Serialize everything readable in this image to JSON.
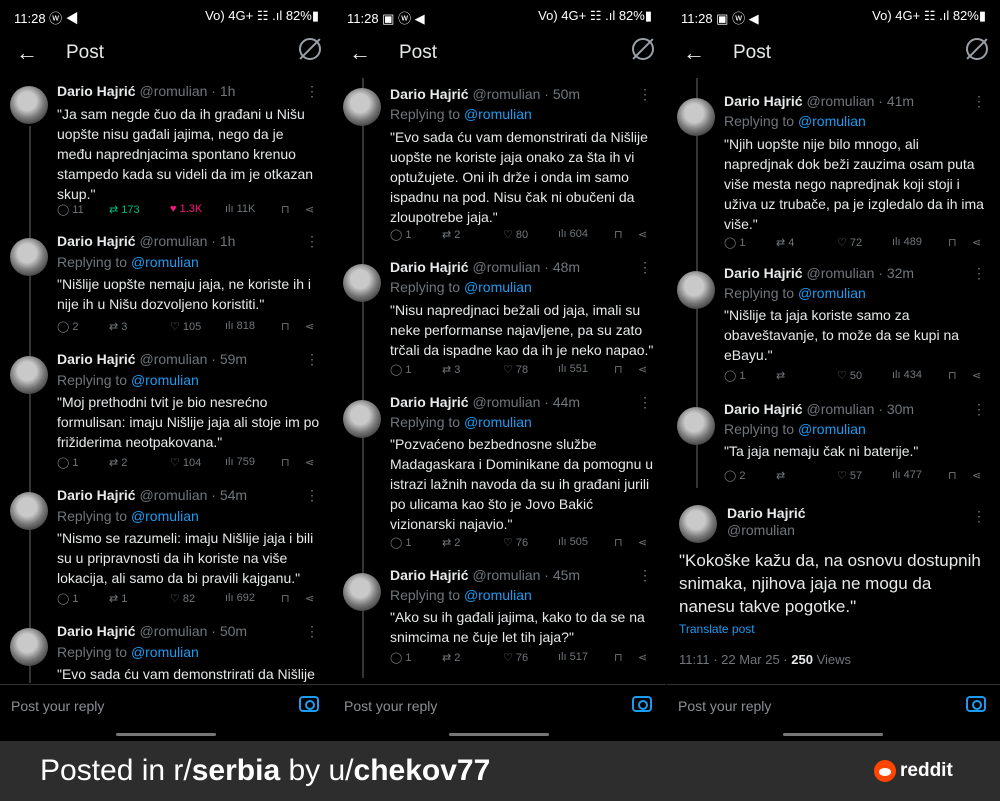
{
  "status": {
    "time": "11:28 ⓦ ◀",
    "time_p1": "11:28 ▣ ⓦ ◀",
    "right": "Vo) 4G+ ☷ .ıl 82%▮"
  },
  "header": {
    "back": "←",
    "title": "Post"
  },
  "reply_placeholder": "Post your reply",
  "panel0": {
    "tweets": [
      {
        "name": "Dario Hajrić",
        "meta": "@romulian · 1h",
        "reply": "",
        "text": "\"Ja sam negde čuo da ih građani u Nišu uopšte nisu gađali jajima, nego da je među naprednjacima spontano krenuo stampedo kada su videli da im je otkazan skup.\"",
        "comments": "11",
        "reposts": "173",
        "likes": "1.3K",
        "views": "11K"
      },
      {
        "name": "Dario Hajrić",
        "meta": "@romulian · 1h",
        "reply": "@romulian",
        "text": "\"Nišlije uopšte nemaju jaja, ne koriste ih i nije ih u Nišu dozvoljeno koristiti.\"",
        "comments": "2",
        "reposts": "3",
        "likes": "105",
        "views": "818"
      },
      {
        "name": "Dario Hajrić",
        "meta": "@romulian · 59m",
        "reply": "@romulian",
        "text": "\"Moj prethodni tvit je bio nesrećno formulisan: imaju Nišlije jaja ali stoje im po frižiderima neotpakovana.\"",
        "comments": "1",
        "reposts": "2",
        "likes": "104",
        "views": "759"
      },
      {
        "name": "Dario Hajrić",
        "meta": "@romulian · 54m",
        "reply": "@romulian",
        "text": "\"Nismo se razumeli: imaju Nišlije jaja i bili su u pripravnosti da ih koriste na više lokacija, ali samo da bi pravili kajganu.\"",
        "comments": "1",
        "reposts": "1",
        "likes": "82",
        "views": "692"
      },
      {
        "name": "Dario Hajrić",
        "meta": "@romulian · 50m",
        "reply": "@romulian",
        "text": "\"Evo sada ću vam demonstrirati da Nišlije",
        "comments": "",
        "reposts": "",
        "likes": "",
        "views": ""
      }
    ]
  },
  "panel1": {
    "tweets": [
      {
        "name": "Dario Hajrić",
        "meta": "@romulian · 50m",
        "reply": "@romulian",
        "text": "\"Evo sada ću vam demonstrirati da Nišlije uopšte ne koriste jaja onako za šta ih vi optužujete. Oni ih drže i onda im samo ispadnu na pod. Nisu čak ni obučeni da zloupotrebe jaja.\"",
        "comments": "1",
        "reposts": "2",
        "likes": "80",
        "views": "604"
      },
      {
        "name": "Dario Hajrić",
        "meta": "@romulian · 48m",
        "reply": "@romulian",
        "text": "\"Nisu napredjnaci bežali od jaja, imali su neke performanse najavljene, pa su zato trčali da ispadne kao da ih je neko napao.\"",
        "comments": "1",
        "reposts": "3",
        "likes": "78",
        "views": "551"
      },
      {
        "name": "Dario Hajrić",
        "meta": "@romulian · 44m",
        "reply": "@romulian",
        "text": "\"Pozvaćeno bezbednosne službe Madagaskara i Dominikane da pomognu u istrazi lažnih navoda da su ih građani jurili po ulicama kao što je Jovo Bakić vizionarski najavio.\"",
        "comments": "1",
        "reposts": "2",
        "likes": "76",
        "views": "505"
      },
      {
        "name": "Dario Hajrić",
        "meta": "@romulian · 45m",
        "reply": "@romulian",
        "text": "\"Ako su ih gađali jajima, kako to da se na snimcima ne čuje let tih jaja?\"",
        "comments": "1",
        "reposts": "2",
        "likes": "76",
        "views": "517"
      }
    ]
  },
  "panel2": {
    "tweets": [
      {
        "name": "Dario Hajrić",
        "meta": "@romulian · 41m",
        "reply": "@romulian",
        "text": "\"Njih uopšte nije bilo mnogo, ali napredjnak dok beži zauzima osam puta više mesta nego napredjnak koji stoji i uživa uz trubače, pa je izgledalo da ih ima više.\"",
        "comments": "1",
        "reposts": "4",
        "likes": "72",
        "views": "489"
      },
      {
        "name": "Dario Hajrić",
        "meta": "@romulian · 32m",
        "reply": "@romulian",
        "text": "\"Nišlije ta jaja koriste samo za obaveštavanje, to može da se kupi na eBayu.\"",
        "comments": "1",
        "reposts": "",
        "likes": "50",
        "views": "434"
      },
      {
        "name": "Dario Hajrić",
        "meta": "@romulian · 30m",
        "reply": "@romulian",
        "text": "\"Ta jaja nemaju čak ni baterije.\"",
        "comments": "2",
        "reposts": "",
        "likes": "57",
        "views": "477"
      }
    ],
    "main": {
      "name": "Dario Hajrić",
      "handle": "@romulian",
      "text": "\"Kokoške kažu da, na osnovu dostupnih snimaka, njihova jaja ne mogu da nanesu takve pogotke.\"",
      "translate": "Translate post",
      "time": "11:11 · 22 Mar 25 · ",
      "views": "250",
      "views_label": " Views"
    }
  },
  "replying_to": "Replying to ",
  "banner": {
    "prefix": "Posted in r/",
    "subreddit": "serbia",
    "by": " by u/",
    "user": "chekov77",
    "logo": "reddit"
  },
  "colors": {
    "accent": "#1d9bf0",
    "repost_active": "#00ba7c",
    "like_active": "#f91880",
    "reddit": "#ff4500"
  }
}
